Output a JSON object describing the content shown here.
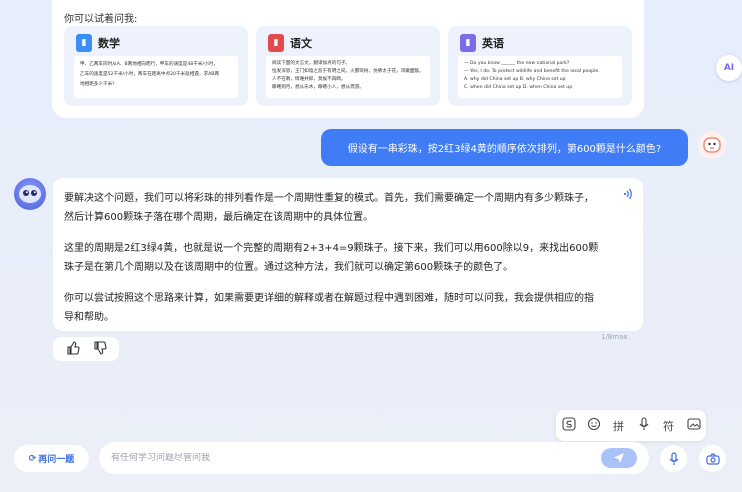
{
  "suggestions": {
    "title": "你可以试着问我:",
    "cards": [
      {
        "subject": "数学",
        "icon": "math-book-icon",
        "color": "#3a8ef6",
        "lines": [
          "甲、乙两车同时从A、B两地相向而行，甲车的速度是48千米/小时，",
          "乙车的速度是52千米/小时，两车在距离中点20千米处相遇，求AB两",
          "地相距多少千米?"
        ]
      },
      {
        "subject": "语文",
        "icon": "chinese-book-icon",
        "color": "#e24b4b",
        "lines": [
          "阅读下面的文言文，翻译加点的句子。",
          "恒发深思，王门如墙之悲于有明之间，火都荣树，仿佛太于花，邓嫩面骸。",
          "人不在哨，情难并抑，莫候不再畸。",
          "睁睹到月，想从乐木，睁睹小人，想从周游。"
        ]
      },
      {
        "subject": "英语",
        "icon": "english-book-icon",
        "color": "#7a6ee8",
        "lines": [
          "— Do you know ______ the new national park?",
          "— Yes, I do. To protect wildlife and benefit the local people.",
          "A. why did China set up     B. why China set up",
          "C. when did China set up     D. when China set up"
        ]
      }
    ]
  },
  "user_message": "假设有一串彩珠，按2红3绿4黄的顺序依次排列，第600颗是什么颜色?",
  "ai_badge": "AI",
  "bot_message": {
    "paragraphs": [
      "要解决这个问题，我们可以将彩珠的排列看作是一个周期性重复的模式。首先，我们需要确定一个周期内有多少颗珠子，然后计算600颗珠子落在哪个周期，最后确定在该周期中的具体位置。",
      "这里的周期是2红3绿4黄，也就是说一个完整的周期有2+3+4=9颗珠子。接下来，我们可以用600除以9，来找出600颗珠子是在第几个周期以及在该周期中的位置。通过这种方法，我们就可以确定第600颗珠子的颜色了。",
      "你可以尝试按照这个思路来计算，如果需要更详细的解释或者在解题过程中遇到困难，随时可以问我，我会提供相应的指导和帮助。"
    ]
  },
  "model_tag": "1/8max",
  "tools": [
    "S",
    "☺",
    "拼",
    "mic",
    "符",
    "img"
  ],
  "bottom": {
    "reask_label": "再问一题",
    "input_placeholder": "有任何学习问题尽管问我"
  }
}
